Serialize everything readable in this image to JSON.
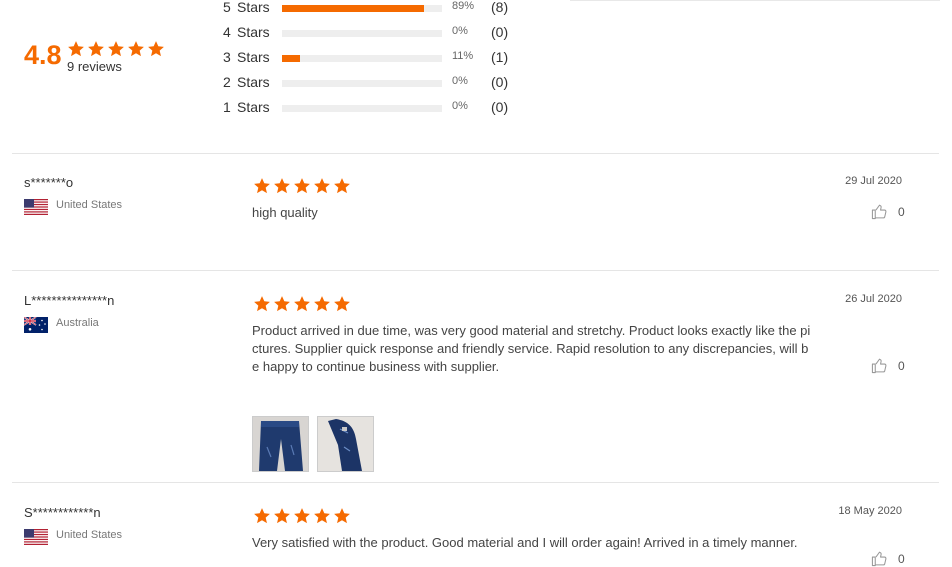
{
  "summary": {
    "average": "4.8",
    "review_count": "9 reviews",
    "star_fill_color": "#f56a00",
    "distribution": [
      {
        "stars": "5",
        "label": "Stars",
        "percent": "89%",
        "fraction": 0.89,
        "count": "(8)"
      },
      {
        "stars": "4",
        "label": "Stars",
        "percent": "0%",
        "fraction": 0,
        "count": "(0)"
      },
      {
        "stars": "3",
        "label": "Stars",
        "percent": "11%",
        "fraction": 0.11,
        "count": "(1)"
      },
      {
        "stars": "2",
        "label": "Stars",
        "percent": "0%",
        "fraction": 0,
        "count": "(0)"
      },
      {
        "stars": "1",
        "label": "Stars",
        "percent": "0%",
        "fraction": 0,
        "count": "(0)"
      }
    ]
  },
  "reviews": [
    {
      "name": "s*******o",
      "country": "United States",
      "flag": "us-flag-icon",
      "rating": 5,
      "date": "29 Jul 2020",
      "text": "high quality",
      "helpful_count": "0",
      "photos": []
    },
    {
      "name": "L***************n",
      "country": "Australia",
      "flag": "au-flag-icon",
      "rating": 5,
      "date": "26 Jul 2020",
      "text": "Product arrived in due time, was very good material and stretchy. Product looks exactly like the pictures. Supplier quick response and friendly service. Rapid resolution to any discrepancies, will be happy to continue business with supplier.",
      "helpful_count": "0",
      "photos": [
        "jeans-photo-1",
        "jeans-photo-2"
      ]
    },
    {
      "name": "S************n",
      "country": "United States",
      "flag": "us-flag-icon",
      "rating": 5,
      "date": "18 May 2020",
      "text": "Very satisfied with the product. Good material and I will order again! Arrived in a timely manner.",
      "helpful_count": "0",
      "photos": []
    }
  ]
}
